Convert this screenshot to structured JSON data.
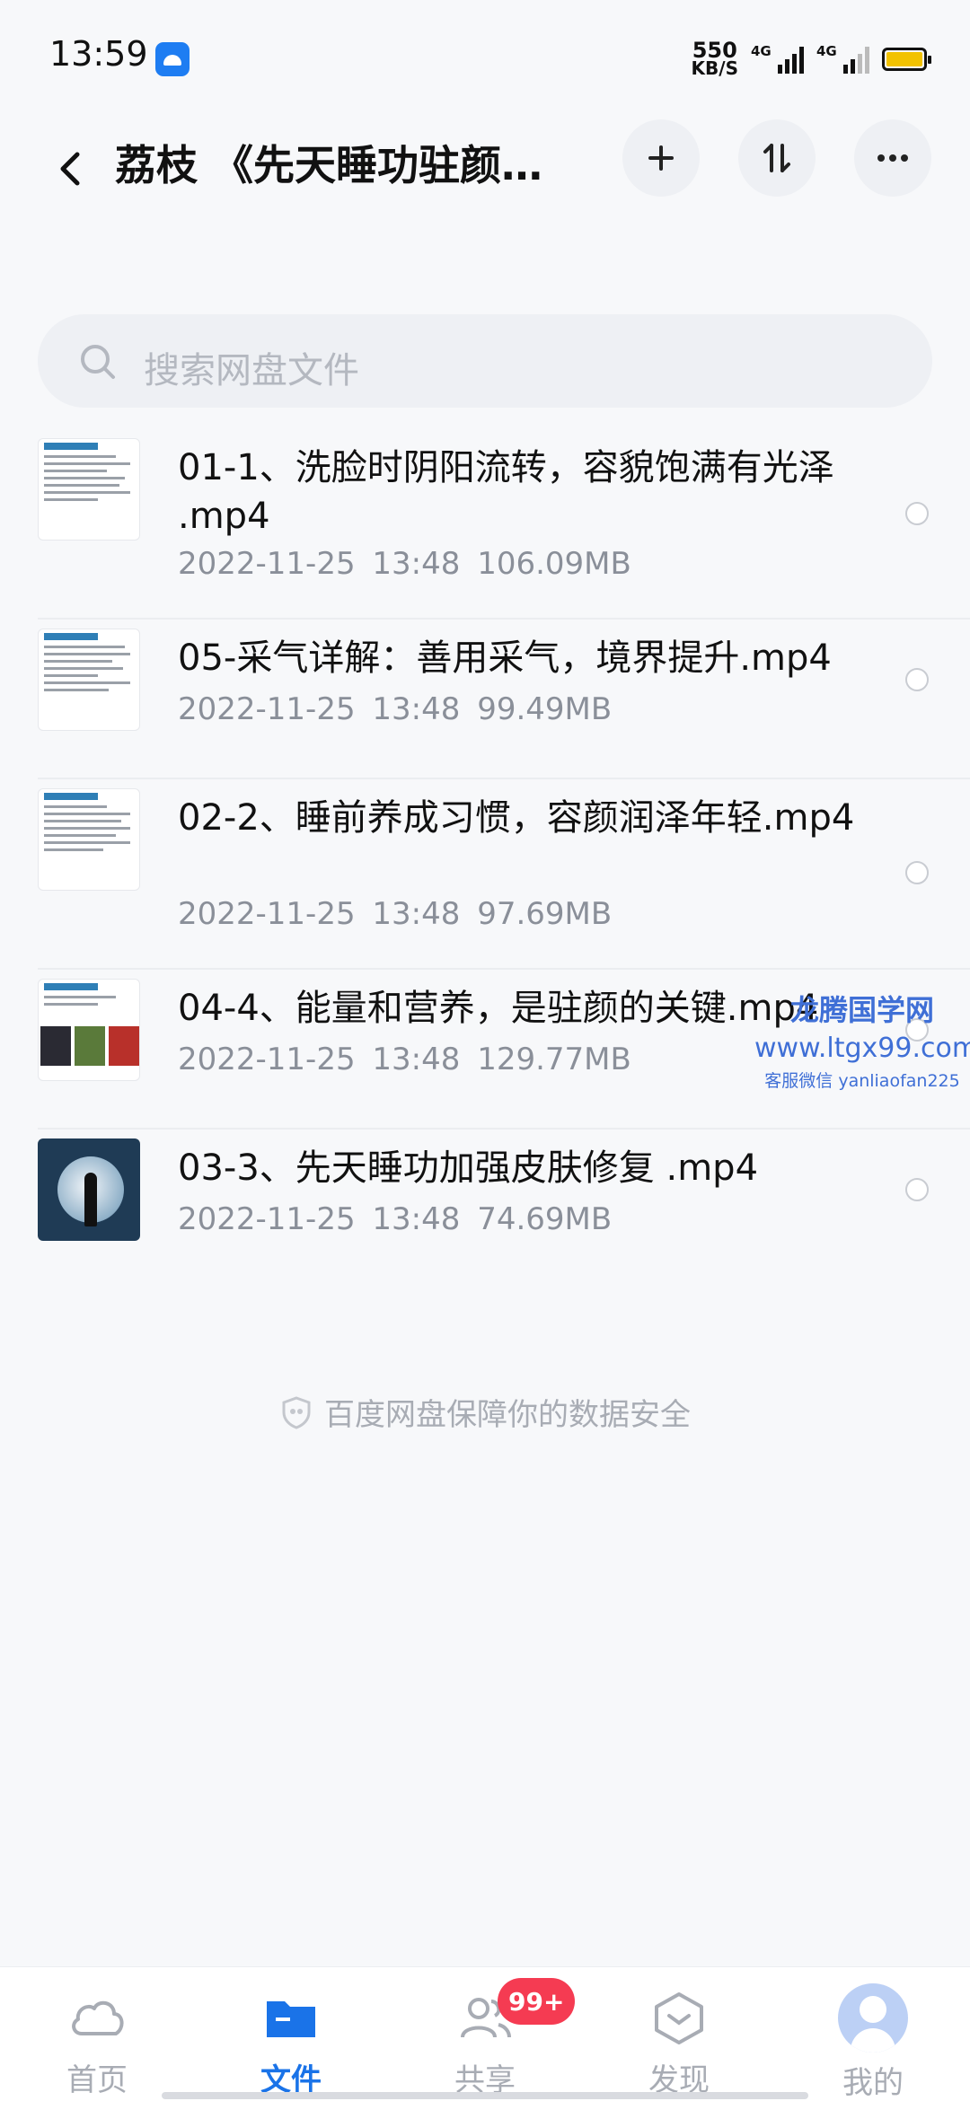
{
  "status_bar": {
    "time": "13:59",
    "net_speed_value": "550",
    "net_speed_unit": "KB/S",
    "signal1_label": "4G",
    "signal2_label": "4G"
  },
  "header": {
    "title": "荔枝 《先天睡功驻颜…",
    "back_icon": "chevron-left-icon",
    "add_icon": "plus-icon",
    "sort_icon": "sort-icon",
    "more_icon": "more-icon"
  },
  "search": {
    "placeholder": "搜索网盘文件"
  },
  "files": [
    {
      "name": "01-1、洗脸时阴阳流转，容貌饱满有光泽 .mp4",
      "date": "2022-11-25",
      "time": "13:48",
      "size": "106.09MB"
    },
    {
      "name": "05-采气详解：善用采气，境界提升.mp4",
      "date": "2022-11-25",
      "time": "13:48",
      "size": "99.49MB"
    },
    {
      "name": "02-2、睡前养成习惯，容颜润泽年轻.mp4",
      "date": "2022-11-25",
      "time": "13:48",
      "size": "97.69MB"
    },
    {
      "name": "04-4、能量和营养，是驻颜的关键.mp4",
      "date": "2022-11-25",
      "time": "13:48",
      "size": "129.77MB"
    },
    {
      "name": "03-3、先天睡功加强皮肤修复 .mp4",
      "date": "2022-11-25",
      "time": "13:48",
      "size": "74.69MB"
    }
  ],
  "watermark": {
    "title": "龙腾国学网",
    "url": "www.ltgx99.com",
    "wechat": "客服微信 yanliaofan225"
  },
  "safety_note": "百度网盘保障你的数据安全",
  "nav": {
    "home": "首页",
    "files": "文件",
    "share": "共享",
    "share_badge": "99+",
    "discover": "发现",
    "mine": "我的"
  },
  "colors": {
    "accent": "#1a73e8",
    "badge": "#f53b52",
    "background": "#f7f8fa"
  }
}
